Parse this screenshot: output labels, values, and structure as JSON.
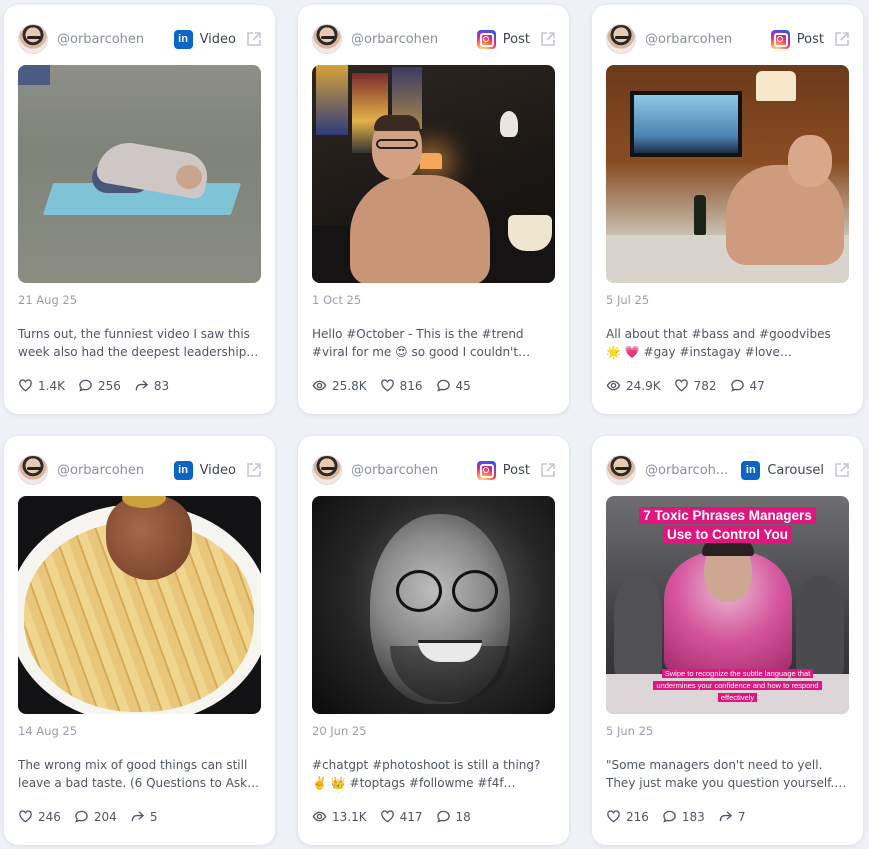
{
  "colors": {
    "background": "#eef1f6",
    "card": "#ffffff",
    "linkedin": "#0a66c2",
    "accent_pink": "#e0167f"
  },
  "cards": [
    {
      "handle": "@orbarcohen",
      "platform_icon": "linkedin-icon",
      "type": "Video",
      "date": "21 Aug 25",
      "caption": "Turns out, the funniest video I saw this week also had the deepest leadership…",
      "stats": [
        {
          "icon": "heart-icon",
          "value": "1.4K"
        },
        {
          "icon": "comment-icon",
          "value": "256"
        },
        {
          "icon": "share-icon",
          "value": "83"
        }
      ]
    },
    {
      "handle": "@orbarcohen",
      "platform_icon": "instagram-icon",
      "type": "Post",
      "date": "1 Oct 25",
      "caption": "Hello #October - This is the #trend #viral for me 😍 so good I couldn't choose just…",
      "stats": [
        {
          "icon": "eye-icon",
          "value": "25.8K"
        },
        {
          "icon": "heart-icon",
          "value": "816"
        },
        {
          "icon": "comment-icon",
          "value": "45"
        }
      ]
    },
    {
      "handle": "@orbarcohen",
      "platform_icon": "instagram-icon",
      "type": "Post",
      "date": "5 Jul 25",
      "caption": "All about that #bass and #goodvibes 🌟 💗 #gay #instagay #love #gayboy…",
      "stats": [
        {
          "icon": "eye-icon",
          "value": "24.9K"
        },
        {
          "icon": "heart-icon",
          "value": "782"
        },
        {
          "icon": "comment-icon",
          "value": "47"
        }
      ]
    },
    {
      "handle": "@orbarcohen",
      "platform_icon": "linkedin-icon",
      "type": "Video",
      "date": "14 Aug 25",
      "caption": "The wrong mix of good things can still leave a bad taste. (6 Questions to Ask…",
      "stats": [
        {
          "icon": "heart-icon",
          "value": "246"
        },
        {
          "icon": "comment-icon",
          "value": "204"
        },
        {
          "icon": "share-icon",
          "value": "5"
        }
      ]
    },
    {
      "handle": "@orbarcohen",
      "platform_icon": "instagram-icon",
      "type": "Post",
      "date": "20 Jun 25",
      "caption": "#chatgpt #photoshoot is still a thing? ✌️ 👑 #toptags #followme #f4f…",
      "stats": [
        {
          "icon": "eye-icon",
          "value": "13.1K"
        },
        {
          "icon": "heart-icon",
          "value": "417"
        },
        {
          "icon": "comment-icon",
          "value": "18"
        }
      ]
    },
    {
      "handle": "@orbarcoh...",
      "platform_icon": "linkedin-icon",
      "type": "Carousel",
      "date": "5 Jun 25",
      "caption": "\"Some managers don't need to yell. They just make you question yourself.\" Not all…",
      "media_title_1": "7 Toxic Phrases Managers",
      "media_title_2": "Use to Control You",
      "media_sub_1": "Swipe to recognize the subtle language that",
      "media_sub_2": "undermines your confidence and how to respond",
      "media_sub_3": "effectively",
      "stats": [
        {
          "icon": "heart-icon",
          "value": "216"
        },
        {
          "icon": "comment-icon",
          "value": "183"
        },
        {
          "icon": "share-icon",
          "value": "7"
        }
      ]
    }
  ]
}
